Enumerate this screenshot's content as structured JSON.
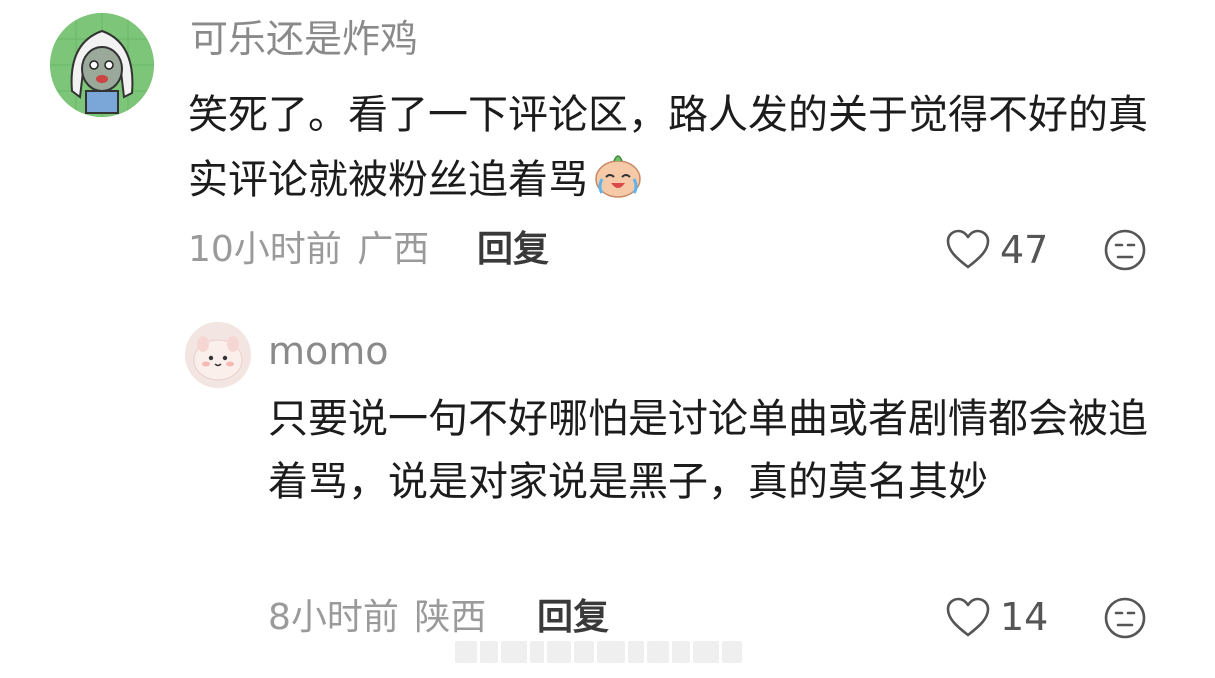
{
  "comments": [
    {
      "username": "可乐还是炸鸡",
      "text": "笑死了。看了一下评论区，路人发的关于觉得不好的真实评论就被粉丝追着骂",
      "emoji_icon": "crying-laughing-bun-emoji-icon",
      "time": "10小时前",
      "location": "广西",
      "reply_label": "回复",
      "likes": "47"
    },
    {
      "username": "momo",
      "text": "只要说一句不好哪怕是讨论单曲或者剧情都会被追着骂，说是对家说是黑子，真的莫名其妙",
      "time": "8小时前",
      "location": "陕西",
      "reply_label": "回复",
      "likes": "14"
    }
  ],
  "colors": {
    "username": "#8a8a8a",
    "meta": "#9a9a9a",
    "text": "#1c1c1c",
    "icon_stroke": "#555555"
  }
}
